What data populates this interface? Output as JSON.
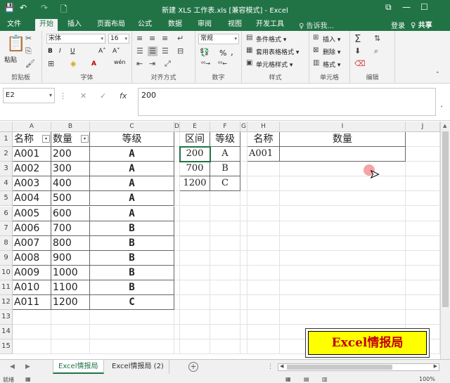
{
  "window": {
    "title": "新建 XLS 工作表.xls [兼容模式] - Excel",
    "buttons": {
      "restore": "⧉",
      "minimize": "—",
      "maximize": "☐"
    }
  },
  "quick_access": {
    "save": "💾",
    "undo": "↶",
    "redo": "↷",
    "preview": "🗋"
  },
  "tabs": [
    {
      "label": "文件"
    },
    {
      "label": "开始"
    },
    {
      "label": "插入"
    },
    {
      "label": "页面布局"
    },
    {
      "label": "公式"
    },
    {
      "label": "数据"
    },
    {
      "label": "审阅"
    },
    {
      "label": "视图"
    },
    {
      "label": "开发工具"
    }
  ],
  "tell_me": "♀ 告诉我...",
  "login": "登录",
  "share": "♀ 共享",
  "ribbon": {
    "clipboard": {
      "paste": "粘贴",
      "label": "剪贴板"
    },
    "font": {
      "name": "宋体",
      "size": "16",
      "bold": "B",
      "italic": "I",
      "underline": "U",
      "grow": "A˄",
      "shrink": "A˅",
      "label": "字体"
    },
    "alignment": {
      "label": "对齐方式"
    },
    "number": {
      "format": "常规",
      "percent": "%",
      "comma": ",",
      "label": "数字"
    },
    "styles": {
      "conditional": "条件格式 ▾",
      "table": "套用表格格式 ▾",
      "cell": "单元格样式 ▾",
      "label": "样式"
    },
    "cells": {
      "insert": "插入 ▾",
      "delete": "删除 ▾",
      "format": "格式 ▾",
      "label": "单元格"
    },
    "editing": {
      "label": "编辑"
    }
  },
  "formula_bar": {
    "name_box": "E2",
    "cancel": "✕",
    "confirm": "✓",
    "fx": "fx",
    "content": "200"
  },
  "columns": [
    {
      "label": "A"
    },
    {
      "label": "B"
    },
    {
      "label": "C"
    },
    {
      "label": "D"
    },
    {
      "label": "E"
    },
    {
      "label": "F"
    },
    {
      "label": "G"
    },
    {
      "label": "H"
    },
    {
      "label": "I"
    },
    {
      "label": "J"
    }
  ],
  "rows": [
    "1",
    "2",
    "3",
    "4",
    "5",
    "6",
    "7",
    "8",
    "9",
    "10",
    "11",
    "12",
    "13",
    "14",
    "15"
  ],
  "table_main": {
    "headers": [
      "名称",
      "数量",
      "等级"
    ],
    "rows": [
      [
        "A001",
        "200",
        "A"
      ],
      [
        "A002",
        "300",
        "A"
      ],
      [
        "A003",
        "400",
        "A"
      ],
      [
        "A004",
        "500",
        "A"
      ],
      [
        "A005",
        "600",
        "A"
      ],
      [
        "A006",
        "700",
        "B"
      ],
      [
        "A007",
        "800",
        "B"
      ],
      [
        "A008",
        "900",
        "B"
      ],
      [
        "A009",
        "1000",
        "B"
      ],
      [
        "A010",
        "1100",
        "B"
      ],
      [
        "A011",
        "1200",
        "C"
      ]
    ]
  },
  "table_range": {
    "headers": [
      "区间",
      "等级"
    ],
    "rows": [
      [
        "200",
        "A"
      ],
      [
        "700",
        "B"
      ],
      [
        "1200",
        "C"
      ]
    ]
  },
  "table_lookup": {
    "headers": [
      "名称",
      "数量"
    ],
    "rows": [
      [
        "A001",
        ""
      ]
    ]
  },
  "badge": "Excel情报局",
  "sheets": [
    {
      "label": "Excel情报局"
    },
    {
      "label": "Excel情报局 (2)"
    }
  ],
  "add_sheet": "+",
  "status": {
    "ready": "就绪",
    "zoom": "100%"
  }
}
